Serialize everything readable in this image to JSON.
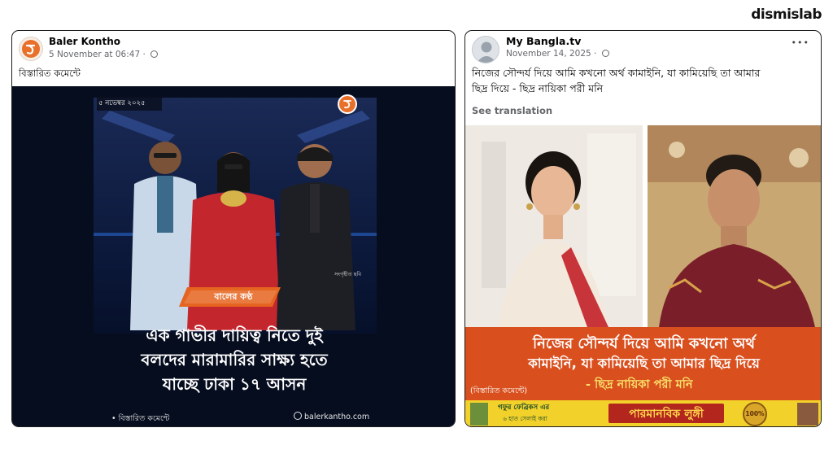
{
  "brand": "dismislab",
  "post1": {
    "page_name": "Baler Kontho",
    "timestamp": "5 November at 06:47",
    "privacy_icon": "globe-icon",
    "text": "বিস্তারিত কমেন্টে",
    "image": {
      "date_badge": "৫ নভেম্বর ২০২৫",
      "photo_credit": "সংগৃহীত ছবি",
      "logo_label": "বালের কণ্ঠ",
      "headline_line1": "এক গাভীর দায়িত্ব নিতে দুই",
      "headline_line2": "বলদের মারামারির সাক্ষ্য হতে",
      "headline_line3": "যাচ্ছে ঢাকা ১৭ আসন",
      "footer_left": "• বিস্তারিত কমেন্টে",
      "footer_right": "balerkantho.com"
    }
  },
  "post2": {
    "page_name": "My Bangla.tv",
    "timestamp": "November 14, 2025",
    "privacy_icon": "globe-icon",
    "text_line1": "নিজের সৌন্দর্য দিয়ে আমি কখনো অর্থ কামাইনি, যা কামিয়েছি তা আমার",
    "text_line2": "ছিদ্র দিয়ে - ছিদ্র নায়িকা পরী মনি",
    "see_translation": "See translation",
    "more_options": "•••",
    "image": {
      "headline_line1": "নিজের সৌন্দর্য দিয়ে আমি কখনো অর্থ",
      "headline_line2": "কামাইনি, যা কামিয়েছি তা আমার ছিদ্র দিয়ে",
      "byline": "- ছিদ্র নায়িকা পরী মনি",
      "badge": "(বিস্তারিত কমেন্টে)",
      "ad_text_small": "গফুর ফেব্রিকস এর",
      "ad_text_small2": "৬ হাত সেলাই করা",
      "ad_text_big": "পারমানবিক লুঙ্গী",
      "ad_seal": "100%"
    }
  },
  "colors": {
    "card_border": "#1c1c1c",
    "meta_gray": "#65676b",
    "orange_banner": "#d94f1e",
    "dark_navy": "#0b1630",
    "logo_orange": "#e8702a",
    "ad_yellow": "#f2d22a"
  }
}
